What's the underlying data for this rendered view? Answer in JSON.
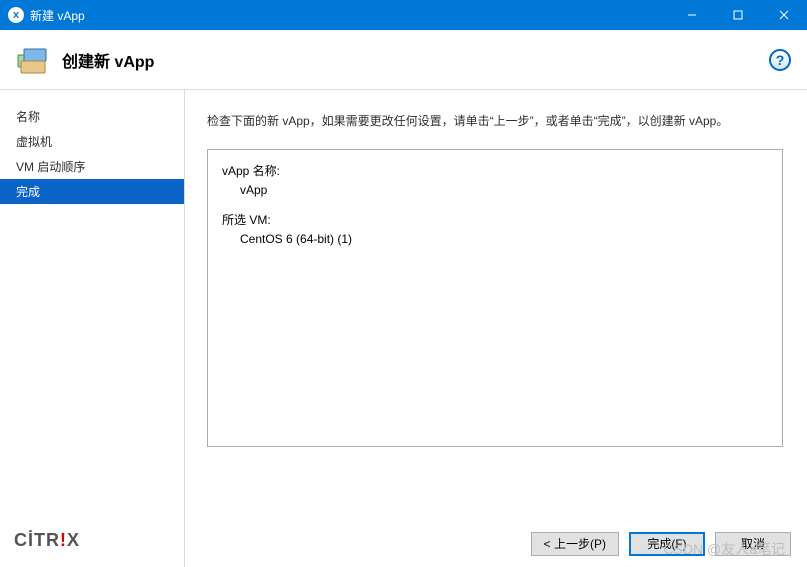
{
  "titlebar": {
    "title": "新建 vApp"
  },
  "header": {
    "title": "创建新 vApp",
    "help_text": "?"
  },
  "sidebar": {
    "items": [
      {
        "label": "名称",
        "selected": false
      },
      {
        "label": "虚拟机",
        "selected": false
      },
      {
        "label": "VM 启动顺序",
        "selected": false
      },
      {
        "label": "完成",
        "selected": true
      }
    ],
    "brand_left": "CİTR",
    "brand_right": "X"
  },
  "content": {
    "intro": "检查下面的新 vApp，如果需要更改任何设置，请单击“上一步”，或者单击“完成”，以创建新 vApp。",
    "vapp_name_label": "vApp 名称:",
    "vapp_name_value": "vApp",
    "selected_vm_label": "所选 VM:",
    "selected_vm_value": "CentOS 6 (64-bit) (1)"
  },
  "buttons": {
    "prev": "< 上一步(P)",
    "finish": "完成(F)",
    "cancel": "取消"
  },
  "watermark": "CSDN @友人a笔记"
}
